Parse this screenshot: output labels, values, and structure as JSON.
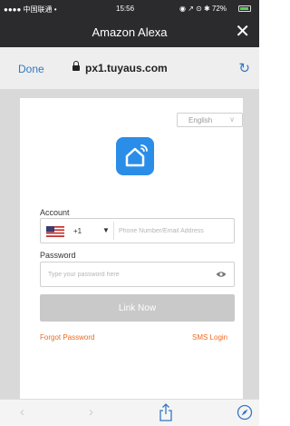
{
  "status_bar": {
    "carrier": "●●●● 中国联通 •",
    "time": "15:56",
    "right_text": "◉ ↗ ⊙ ✱ 72%"
  },
  "app_bar": {
    "title": "Amazon Alexa",
    "close": "✕"
  },
  "browser": {
    "done": "Done",
    "url": "px1.tuyaus.com",
    "reload": "↻"
  },
  "login": {
    "language": "English",
    "language_caret": "∨",
    "account_label": "Account",
    "country_code": "+1",
    "country_caret": "▼",
    "phone_placeholder": "Phone Number/Email Address",
    "password_label": "Password",
    "password_placeholder": "Type your password here",
    "link_button": "Link Now",
    "forgot_password": "Forgot Password",
    "sms_login": "SMS Login",
    "accent_color": "#ee6a23",
    "logo_color": "#2a8ee8"
  },
  "toolbar": {
    "back": "‹",
    "forward": "›",
    "icons": [
      "back-icon",
      "forward-icon",
      "share-icon",
      "compass-icon"
    ]
  }
}
